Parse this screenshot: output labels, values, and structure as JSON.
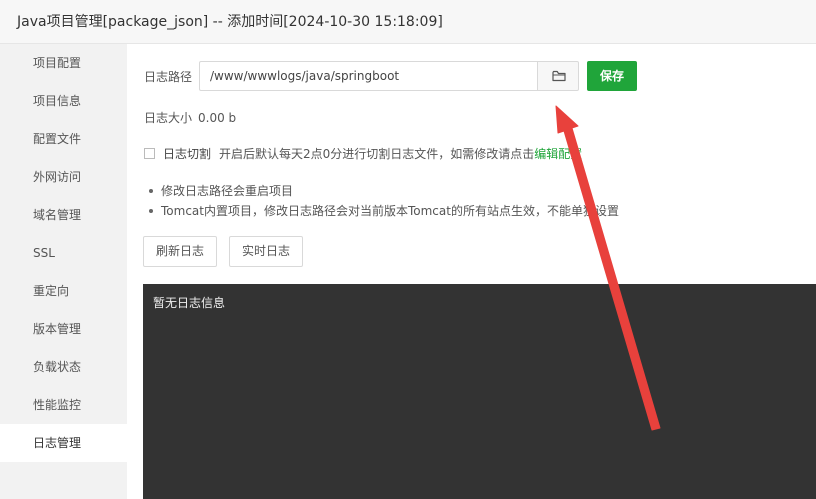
{
  "window": {
    "title": "Java项目管理[package_json] -- 添加时间[2024-10-30 15:18:09]"
  },
  "sidebar": {
    "items": [
      {
        "label": "项目配置"
      },
      {
        "label": "项目信息"
      },
      {
        "label": "配置文件"
      },
      {
        "label": "外网访问"
      },
      {
        "label": "域名管理"
      },
      {
        "label": "SSL"
      },
      {
        "label": "重定向"
      },
      {
        "label": "版本管理"
      },
      {
        "label": "负载状态"
      },
      {
        "label": "性能监控"
      },
      {
        "label": "日志管理"
      }
    ],
    "active": "日志管理"
  },
  "log_path": {
    "label": "日志路径",
    "value": "/www/wwwlogs/java/springboot",
    "save_label": "保存",
    "folder_icon": "folder-icon"
  },
  "log_size": {
    "label": "日志大小",
    "value": "0.00 b"
  },
  "log_cut": {
    "label": "日志切割",
    "description": "开启后默认每天2点0分进行切割日志文件，如需修改请点击",
    "link": "编辑配置",
    "checked": false
  },
  "tips": [
    "修改日志路径会重启项目",
    "Tomcat内置项目，修改日志路径会对当前版本Tomcat的所有站点生效，不能单独设置"
  ],
  "actions": {
    "refresh_label": "刷新日志",
    "realtime_label": "实时日志"
  },
  "log_panel": {
    "empty_text": "暂无日志信息"
  },
  "colors": {
    "accent": "#20a53a",
    "log_bg": "#333333",
    "annotation_arrow": "#e8413c"
  }
}
